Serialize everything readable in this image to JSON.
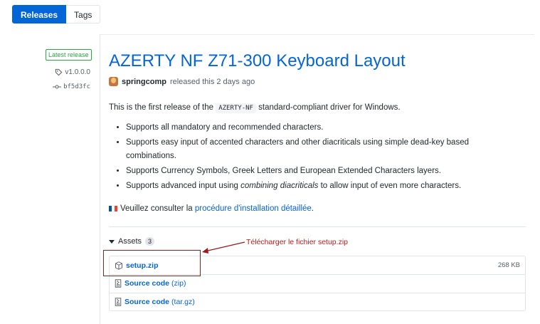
{
  "tabs": {
    "releases": "Releases",
    "tags": "Tags"
  },
  "release": {
    "badge": "Latest release",
    "tag": "v1.0.0.0",
    "commit": "bf5d3fc",
    "title": "AZERTY NF Z71-300 Keyboard Layout",
    "author": "springcomp",
    "released": "released this 2 days ago",
    "intro_before": "This is the first release of the ",
    "intro_code": "AZERTY-NF",
    "intro_after": " standard-compliant driver for Windows.",
    "bullets": [
      "Supports all mandatory and recommended characters.",
      "Supports easy input of accented characters and other diacriticals using simple dead-key based combinations.",
      "Supports Currency Symbols, Greek Letters and European Extended Characters layers."
    ],
    "bullet4_before": "Supports advanced input using ",
    "bullet4_em": "combining diacriticals",
    "bullet4_after": " to allow input of even more characters.",
    "french_before": "Veuillez consulter la ",
    "french_link": "procédure d'installation détaillée",
    "french_after": ".",
    "flag_colors": [
      "#0055a4",
      "#ffffff",
      "#ef4135"
    ]
  },
  "assets": {
    "label": "Assets",
    "count": "3",
    "items": [
      {
        "name": "setup.zip",
        "sub": "",
        "size": "268 KB",
        "icon": "package-icon"
      },
      {
        "name": "Source code",
        "sub": "(zip)",
        "size": "",
        "icon": "file-zip-icon"
      },
      {
        "name": "Source code",
        "sub": "(tar.gz)",
        "size": "",
        "icon": "file-zip-icon"
      }
    ]
  },
  "annotation": {
    "text": "Télécharger le fichier setup.zip",
    "color": "#c0191b"
  },
  "colors": {
    "accent": "#0366d6",
    "success": "#28a745"
  }
}
